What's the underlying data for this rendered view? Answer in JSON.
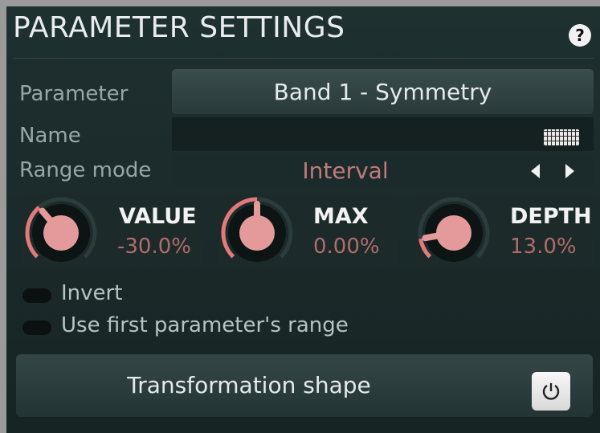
{
  "title": "PARAMETER SETTINGS",
  "help_label": "?",
  "parameter": {
    "label": "Parameter",
    "value": "Band 1 - Symmetry"
  },
  "name": {
    "label": "Name",
    "value": ""
  },
  "range_mode": {
    "label": "Range mode",
    "value": "Interval"
  },
  "knobs": [
    {
      "label": "VALUE",
      "value": "-30.0%",
      "arc_fraction": 0.35
    },
    {
      "label": "MAX",
      "value": "0.00%",
      "arc_fraction": 0.5
    },
    {
      "label": "DEPTH",
      "value": "13.0%",
      "arc_fraction": 0.13
    }
  ],
  "toggles": [
    {
      "label": "Invert",
      "on": false
    },
    {
      "label": "Use first parameter's range",
      "on": false
    }
  ],
  "transformation_button": {
    "label": "Transformation shape"
  },
  "colors": {
    "accent": "#e27a7a",
    "value_text": "#b06c6c",
    "panel": "#1d2b2b"
  },
  "icons": [
    "help-icon",
    "keyboard-icon",
    "arrow-left-icon",
    "arrow-right-icon",
    "power-icon"
  ]
}
